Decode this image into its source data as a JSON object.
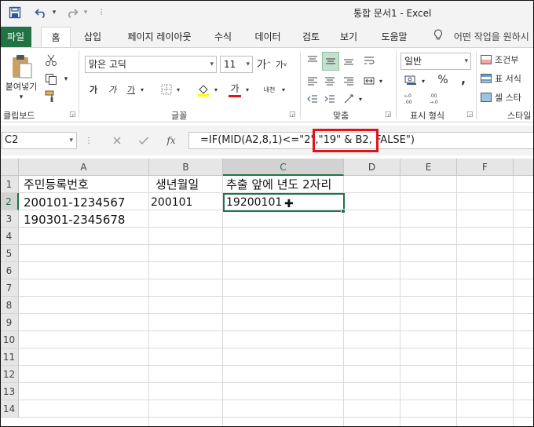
{
  "titlebar": {
    "title": "통합 문서1  -  Excel"
  },
  "tabs": [
    {
      "label": "파일"
    },
    {
      "label": "홈"
    },
    {
      "label": "삽입"
    },
    {
      "label": "페이지 레이아웃"
    },
    {
      "label": "수식"
    },
    {
      "label": "데이터"
    },
    {
      "label": "검토"
    },
    {
      "label": "보기"
    },
    {
      "label": "도움말"
    }
  ],
  "tell_me": {
    "text": "어떤 작업을 원하시"
  },
  "ribbon": {
    "clipboard": {
      "paste_label": "붙여넣기",
      "group_label": "클립보드"
    },
    "font": {
      "font_name": "맑은 고딕",
      "font_size": "11",
      "grow_label": "가",
      "shrink_label": "가",
      "bold": "가",
      "italic": "가",
      "underline": "가",
      "font_color_label": "가",
      "phonetic_label": "내천",
      "group_label": "글꼴"
    },
    "alignment": {
      "group_label": "맞춤"
    },
    "number": {
      "format": "일반",
      "percent": "%",
      "comma": ",",
      "group_label": "표시 형식"
    },
    "styles": {
      "conditional": "조건부",
      "table_format": "표 서식",
      "cell_styles": "셀 스타",
      "group_label": "스타일"
    }
  },
  "formula_bar": {
    "name_box": "C2",
    "fx_label": "fx",
    "formula": "=IF(MID(A2,8,1)<=\"2\",\"19\" & B2, FALSE\")"
  },
  "sheet": {
    "columns": [
      "A",
      "B",
      "C",
      "D",
      "E",
      "F"
    ],
    "rows": [
      "1",
      "2",
      "3",
      "4",
      "5",
      "6",
      "7",
      "8",
      "9",
      "10",
      "11",
      "12",
      "13",
      "14"
    ],
    "cells": {
      "A1": "주민등록번호",
      "B1": "생년월일",
      "C1": "추출 앞에 년도 2자리",
      "A2": "200101-1234567",
      "B2": "200101",
      "C2": "19200101",
      "A3": "190301-2345678"
    }
  },
  "colors": {
    "excel_green": "#217346",
    "highlight_red": "#e0131a"
  }
}
